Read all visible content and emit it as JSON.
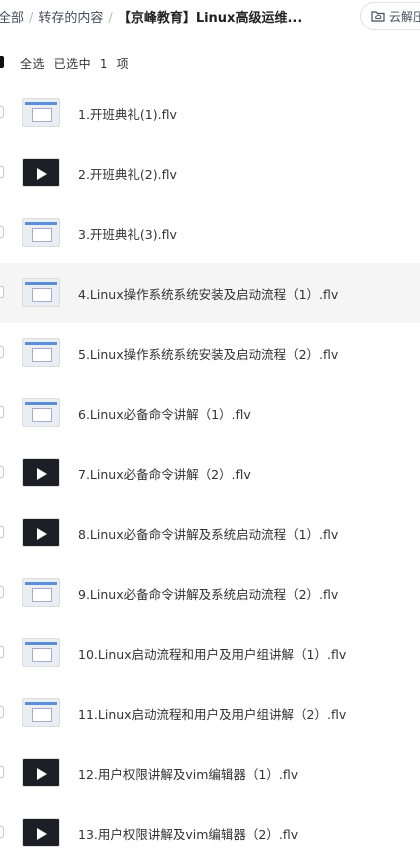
{
  "breadcrumb": {
    "root": "全部",
    "separator": "/",
    "parent": "转存的内容",
    "current": "【京峰教育】Linux高级运维..."
  },
  "cloud_button": {
    "label": "云解压",
    "icon": "folder-cloud-icon"
  },
  "selection": {
    "select_all": "全选",
    "selected_prefix": "已选中",
    "count": "1",
    "unit": "项"
  },
  "files": [
    {
      "name": "1.开班典礼(1).flv",
      "thumb": "light"
    },
    {
      "name": "2.开班典礼(2).flv",
      "thumb": "dark"
    },
    {
      "name": "3.开班典礼(3).flv",
      "thumb": "light"
    },
    {
      "name": "4.Linux操作系统系统安装及启动流程（1）.flv",
      "thumb": "light"
    },
    {
      "name": "5.Linux操作系统系统安装及启动流程（2）.flv",
      "thumb": "light"
    },
    {
      "name": "6.Linux必备命令讲解（1）.flv",
      "thumb": "light"
    },
    {
      "name": "7.Linux必备命令讲解（2）.flv",
      "thumb": "dark"
    },
    {
      "name": "8.Linux必备命令讲解及系统启动流程（1）.flv",
      "thumb": "dark"
    },
    {
      "name": "9.Linux必备命令讲解及系统启动流程（2）.flv",
      "thumb": "light"
    },
    {
      "name": "10.Linux启动流程和用户及用户组讲解（1）.flv",
      "thumb": "light"
    },
    {
      "name": "11.Linux启动流程和用户及用户组讲解（2）.flv",
      "thumb": "light"
    },
    {
      "name": "12.用户权限讲解及vim编辑器（1）.flv",
      "thumb": "dark"
    },
    {
      "name": "13.用户权限讲解及vim编辑器（2）.flv",
      "thumb": "dark"
    }
  ],
  "colors": {
    "hover_row": "#f5f5f6",
    "text": "#333333",
    "accent": "#5b8ed6"
  }
}
